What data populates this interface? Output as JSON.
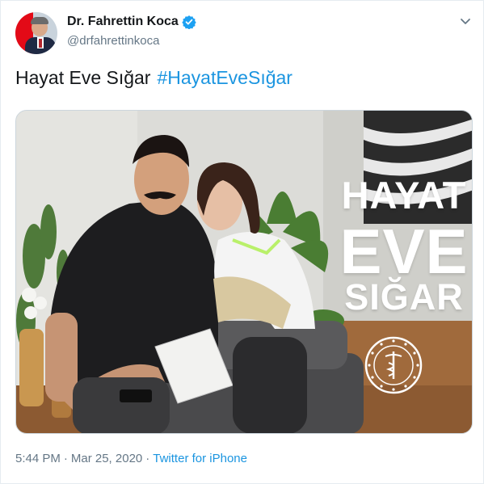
{
  "author": {
    "display_name": "Dr. Fahrettin Koca",
    "handle": "@drfahrettinkoca"
  },
  "tweet": {
    "text": "Hayat Eve Sığar",
    "hashtag": "#HayatEveSığar"
  },
  "media": {
    "overlay_line1": "HAYAT",
    "overlay_line2": "EVE",
    "overlay_line3": "SIĞAR",
    "seal_icon": "ministry-of-health-seal"
  },
  "meta": {
    "time": "5:44 PM",
    "date": "Mar 25, 2020",
    "separator": "·",
    "source": "Twitter for iPhone"
  },
  "icons": {
    "verified": "verified-badge-icon",
    "menu": "chevron-down-icon"
  },
  "colors": {
    "link": "#1b95e0",
    "text": "#14171a",
    "secondary": "#657786",
    "verified": "#1da1f2"
  }
}
